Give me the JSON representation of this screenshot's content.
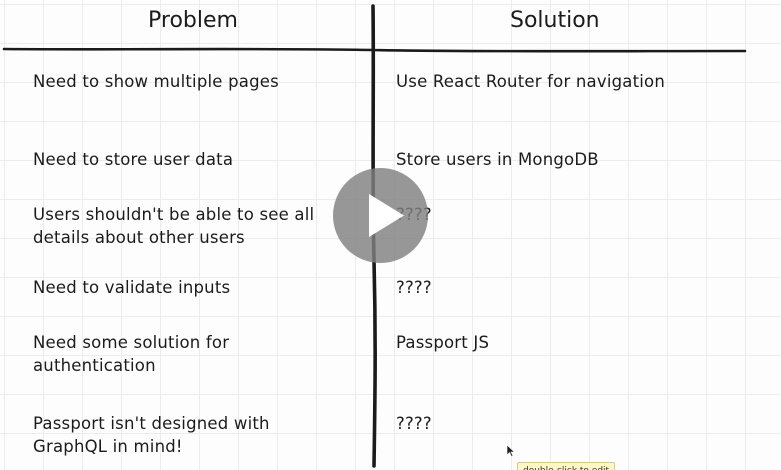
{
  "table": {
    "headers": {
      "problem": "Problem",
      "solution": "Solution"
    },
    "rows": [
      {
        "problem": [
          "Need to show multiple pages"
        ],
        "solution": "Use React Router for navigation"
      },
      {
        "problem": [
          "Need to store user data"
        ],
        "solution": "Store users in MongoDB"
      },
      {
        "problem": [
          "Users shouldn't be able to see all",
          "details about other users"
        ],
        "solution": "????"
      },
      {
        "problem": [
          "Need to validate inputs"
        ],
        "solution": "????"
      },
      {
        "problem": [
          "Need some solution for",
          "authentication"
        ],
        "solution": "Passport JS"
      },
      {
        "problem": [
          "Passport isn't designed with",
          "GraphQL in mind!"
        ],
        "solution": "????"
      }
    ]
  },
  "player": {
    "play_icon": "play-icon"
  },
  "tooltip": {
    "text": "double-click to edit"
  },
  "colors": {
    "ink": "#1b1b1b",
    "grid": "#ececec",
    "play_overlay": "#808080",
    "tooltip_bg": "#fff7c6"
  }
}
